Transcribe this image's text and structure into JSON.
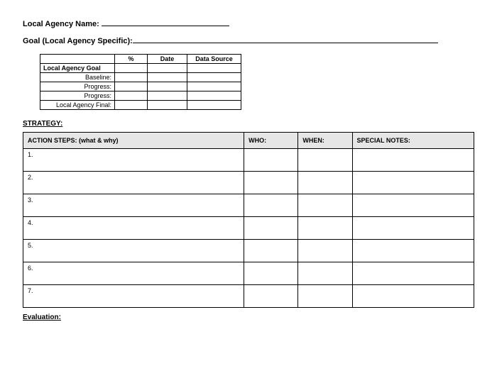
{
  "fields": {
    "agency_name_label": "Local Agency Name:",
    "goal_label": "Goal (Local Agency Specific):"
  },
  "goal_table": {
    "headers": {
      "blank": "",
      "pct": "%",
      "date": "Date",
      "source": "Data Source"
    },
    "row_header": "Local Agency Goal",
    "rows": [
      {
        "label": "Baseline:",
        "pct": "",
        "date": "",
        "source": ""
      },
      {
        "label": "Progress:",
        "pct": "",
        "date": "",
        "source": ""
      },
      {
        "label": "Progress:",
        "pct": "",
        "date": "",
        "source": ""
      },
      {
        "label": "Local Agency Final:",
        "pct": "",
        "date": "",
        "source": ""
      }
    ]
  },
  "strategy_label": "STRATEGY:",
  "action_table": {
    "headers": {
      "action": "ACTION STEPS: (what & why)",
      "who": "WHO:",
      "when": "WHEN:",
      "notes": "SPECIAL NOTES:"
    },
    "rows": [
      {
        "n": "1.",
        "who": "",
        "when": "",
        "notes": ""
      },
      {
        "n": "2.",
        "who": "",
        "when": "",
        "notes": ""
      },
      {
        "n": "3.",
        "who": "",
        "when": "",
        "notes": ""
      },
      {
        "n": "4.",
        "who": "",
        "when": "",
        "notes": ""
      },
      {
        "n": "5.",
        "who": "",
        "when": "",
        "notes": ""
      },
      {
        "n": "6.",
        "who": "",
        "when": "",
        "notes": ""
      },
      {
        "n": "7.",
        "who": "",
        "when": "",
        "notes": ""
      }
    ]
  },
  "evaluation_label": "Evaluation:"
}
